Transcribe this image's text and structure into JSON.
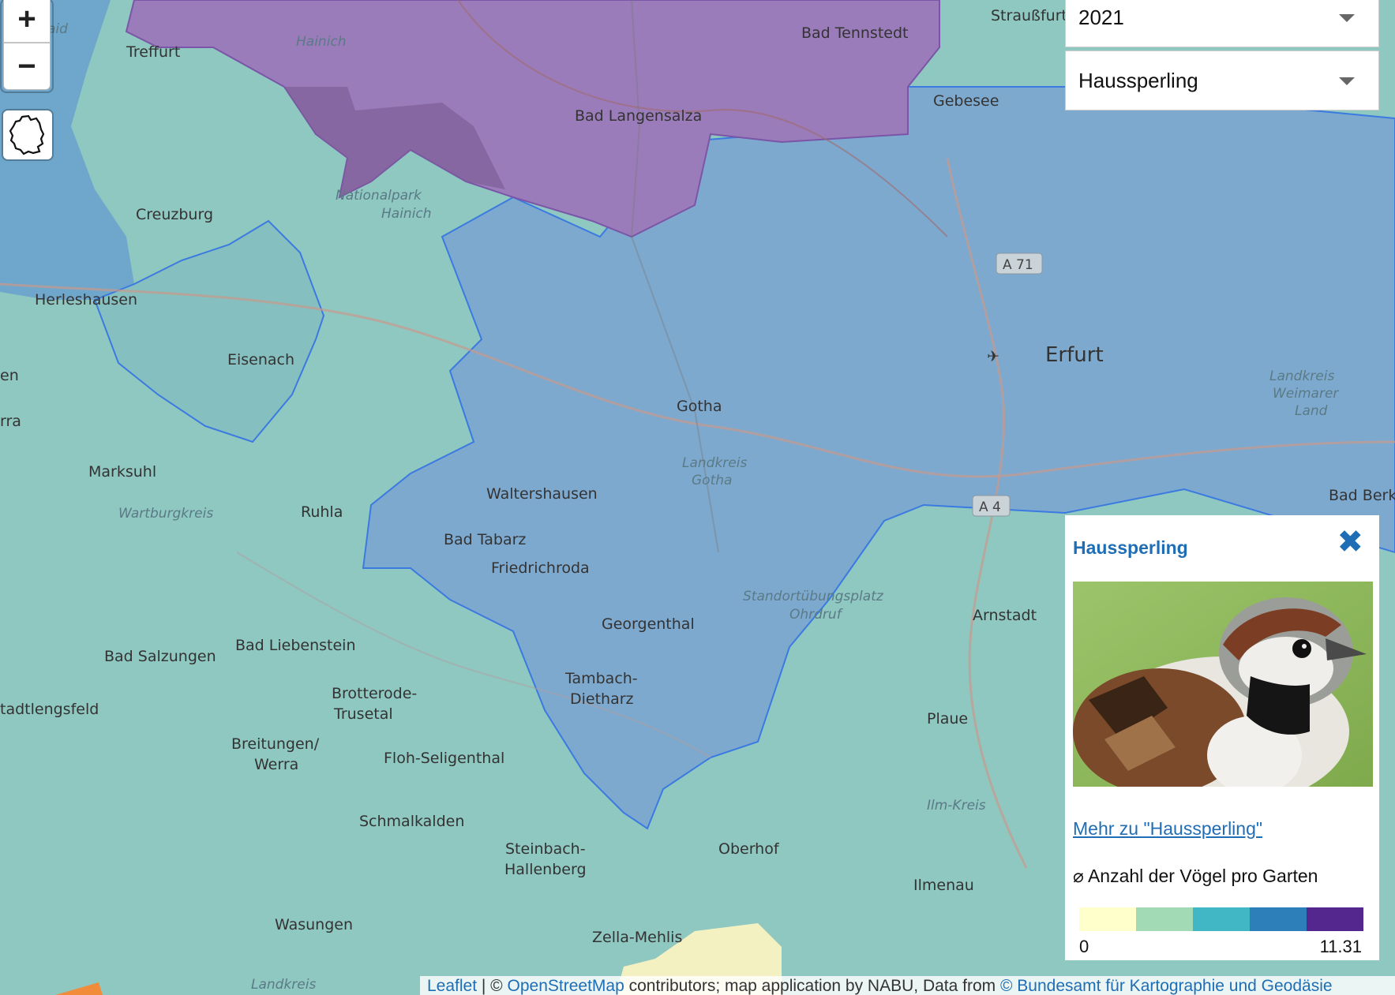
{
  "map": {
    "places": [
      {
        "name": "Treffurt"
      },
      {
        "name": "Hainich"
      },
      {
        "name": "Bad Tennstedt"
      },
      {
        "name": "Straußfurt"
      },
      {
        "name": "Gebesee"
      },
      {
        "name": "Bad Langensalza"
      },
      {
        "name": "Creuzburg"
      },
      {
        "name": "Nationalpark"
      },
      {
        "name": "Hainich"
      },
      {
        "name": "Herleshausen"
      },
      {
        "name": "Eisenach"
      },
      {
        "name": "Marksuhl"
      },
      {
        "name": "Wartburgkreis"
      },
      {
        "name": "Ruhla"
      },
      {
        "name": "Gotha"
      },
      {
        "name": "Landkreis"
      },
      {
        "name": "Gotha"
      },
      {
        "name": "Waltershausen"
      },
      {
        "name": "Bad Tabarz"
      },
      {
        "name": "Friedrichroda"
      },
      {
        "name": "Georgenthal"
      },
      {
        "name": "Standortübungsplatz"
      },
      {
        "name": "Ohrdruf"
      },
      {
        "name": "Tambach-"
      },
      {
        "name": "Dietharz"
      },
      {
        "name": "Bad Salzungen"
      },
      {
        "name": "Bad Liebenstein"
      },
      {
        "name": "Brotterode-"
      },
      {
        "name": "Trusetal"
      },
      {
        "name": "tadtlengsfeld"
      },
      {
        "name": "Breitungen/"
      },
      {
        "name": "Werra"
      },
      {
        "name": "Floh-Seligenthal"
      },
      {
        "name": "Schmalkalden"
      },
      {
        "name": "Steinbach-"
      },
      {
        "name": "Hallenberg"
      },
      {
        "name": "Oberhof"
      },
      {
        "name": "Wasungen"
      },
      {
        "name": "Zella-Mehlis"
      },
      {
        "name": "Landkreis"
      },
      {
        "name": "Erfurt"
      },
      {
        "name": "Landkreis"
      },
      {
        "name": "Weimarer"
      },
      {
        "name": "Land"
      },
      {
        "name": "Arnstadt"
      },
      {
        "name": "Plaue"
      },
      {
        "name": "Ilm-Kreis"
      },
      {
        "name": "Ilmenau"
      },
      {
        "name": "Bad Berk"
      },
      {
        "name": "A 71"
      },
      {
        "name": "A 4"
      },
      {
        "name": "aid"
      },
      {
        "name": "en"
      },
      {
        "name": "rra"
      }
    ]
  },
  "controls": {
    "zoom_in": "+",
    "zoom_out": "−",
    "germany_icon": "germany-outline-icon"
  },
  "filters": {
    "year": "2021",
    "species": "Haussperling"
  },
  "info_panel": {
    "title": "Haussperling",
    "close_icon": "close-x-icon",
    "photo": "house-sparrow-photo",
    "more_link": "Mehr zu \"Haussperling\"",
    "legend_title": "⌀ Anzahl der Vögel pro Garten",
    "legend_min": "0",
    "legend_max": "11.31",
    "legend_colors": [
      "#ffffcc",
      "#a1dab4",
      "#41b6c4",
      "#2c7fb8",
      "#54278f"
    ]
  },
  "attribution": {
    "leaflet": "Leaflet",
    "sep1": " | © ",
    "osm": "OpenStreetMap",
    "text": " contributors; map application by NABU, Data from ",
    "bkg": "© Bundesamt für Kartographie und Geodäsie"
  }
}
